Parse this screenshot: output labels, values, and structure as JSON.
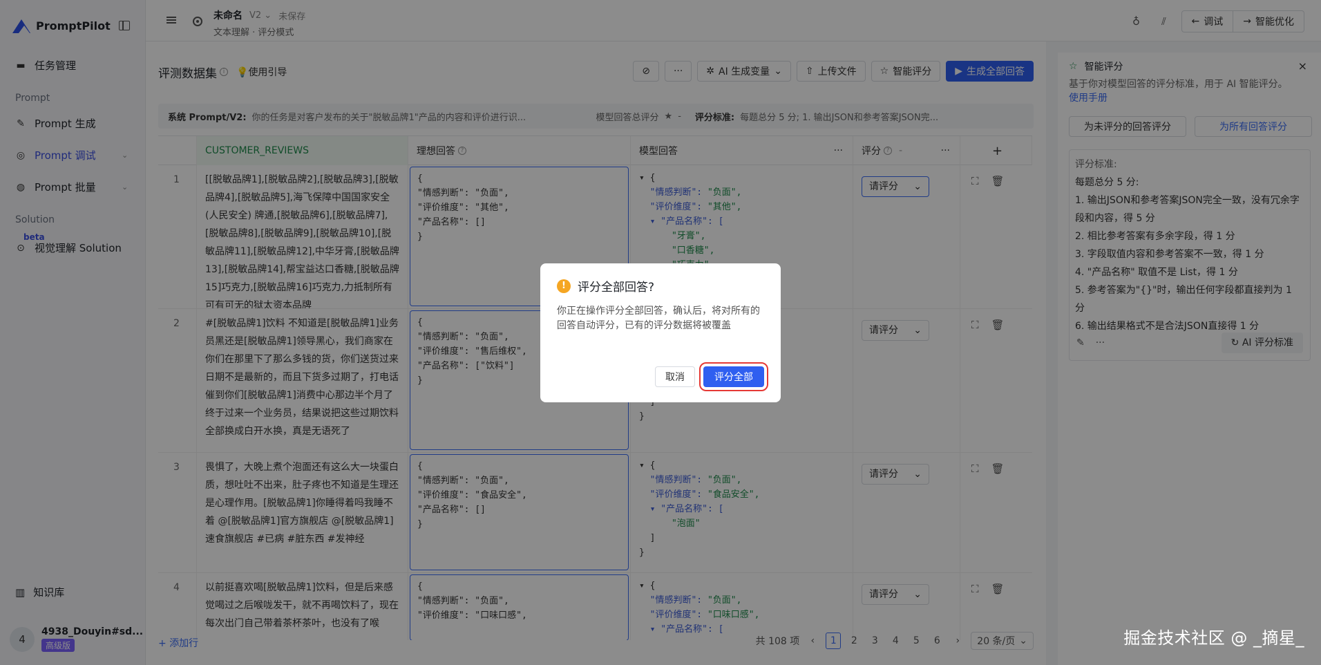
{
  "app": {
    "name": "PromptPilot"
  },
  "sidebar": {
    "items": [
      {
        "label": "任务管理",
        "icon": "folder-icon"
      },
      {
        "label": "Prompt 生成",
        "icon": "wand-icon"
      },
      {
        "label": "Prompt 调试",
        "icon": "debug-icon"
      },
      {
        "label": "Prompt 批量",
        "icon": "batch-icon"
      },
      {
        "label": "视觉理解 Solution",
        "icon": "vision-icon"
      }
    ],
    "section_prompt": "Prompt",
    "section_solution": "Solution",
    "beta": "beta",
    "knowledge": "知识库",
    "user": {
      "avatar": "4",
      "name": "4938_Douyin#sd...",
      "tier": "高级版"
    }
  },
  "header": {
    "title": "未命名",
    "version": "V2",
    "saved": "未保存",
    "subtitle": "文本理解 · 评分模式",
    "debug": "调试",
    "optimize": "智能优化"
  },
  "toolbar": {
    "title": "评测数据集",
    "guide": "使用引导",
    "ai_gen": "AI 生成变量",
    "upload": "上传文件",
    "smart_score": "智能评分",
    "gen_all": "生成全部回答"
  },
  "sysbar": {
    "label": "系统 Prompt/V2:",
    "text": "你的任务是对客户发布的关于\"脱敏品牌1\"产品的内容和评价进行识...",
    "total_label": "模型回答总评分",
    "total_value": "-",
    "std_label": "评分标准:",
    "std_text": "每题总分 5 分;  1. 输出JSON和参考答案JSON完..."
  },
  "table": {
    "headers": {
      "customer_reviews": "CUSTOMER_REVIEWS",
      "ideal": "理想回答",
      "model": "模型回答",
      "score": "评分",
      "score_dash": "-"
    },
    "rows": [
      {
        "idx": "1",
        "review": "[[脱敏品牌1],[脱敏品牌2],[脱敏品牌3],[脱敏品牌4],[脱敏品牌5],海飞保障中国国家安全(人民安全) 牌通,[脱敏品牌6],[脱敏品牌7],[脱敏品牌8],[脱敏品牌9],[脱敏品牌10],[脱敏品牌11],[脱敏品牌12],中华牙膏,[脱敏品牌13],[脱敏品牌14],帮宝益达口香糖,[脱敏品牌15]巧克力,[脱敏品牌16]巧克力,力抵制所有可有可无的狱太资本品牌",
        "ideal": [
          "{",
          "\"情感判断\": \"负面\",",
          "\"评价维度\": \"其他\",",
          "\"产品名称\": []",
          "}"
        ],
        "model": [
          [
            "▾ {",
            ""
          ],
          [
            "  \"情感判断\": ",
            "\"负面\","
          ],
          [
            "  \"评价维度\": ",
            "\"其他\","
          ],
          [
            "  ▾ \"产品名称\": [",
            ""
          ],
          [
            "      ",
            "\"牙膏\","
          ],
          [
            "      ",
            "\"口香糖\","
          ],
          [
            "      ",
            "\"巧克力\""
          ]
        ],
        "score": "请评分"
      },
      {
        "idx": "2",
        "review": "#[脱敏品牌1]饮料 不知道是[脱敏品牌1]业务员黑还是[脱敏品牌1]领导黑心，我们商家在你们在那里下了那么多钱的货，你们送货过来日期不是最新的，而且下货多过期了，打电话催到你们[脱敏品牌1]消费中心那边半个月了终于过来一个业务员，结果说把这些过期饮料全部换成白开水换，真是无语死了",
        "ideal": [
          "{",
          "\"情感判断\": \"负面\",",
          "\"评价维度\": \"售后维权\",",
          "\"产品名称\": [\"饮料\"]",
          "}"
        ],
        "model": [
          [
            "  ]",
            ""
          ],
          [
            "}",
            ""
          ]
        ],
        "score": "请评分"
      },
      {
        "idx": "3",
        "review": "畏惧了，大晚上煮个泡面还有这么大一块蛋白质，想吐吐不出来，肚子疼也不知道是生理还是心理作用。[脱敏品牌1]你睡得着吗我睡不着 @[脱敏品牌1]官方旗舰店 @[脱敏品牌1]速食旗舰店 #已病 #脏东西 #发神经",
        "ideal": [
          "{",
          "\"情感判断\": \"负面\",",
          "\"评价维度\": \"食品安全\",",
          "\"产品名称\": []",
          "}"
        ],
        "model": [
          [
            "▾ {",
            ""
          ],
          [
            "  \"情感判断\": ",
            "\"负面\","
          ],
          [
            "  \"评价维度\": ",
            "\"食品安全\","
          ],
          [
            "  ▾ \"产品名称\": [",
            ""
          ],
          [
            "      ",
            "\"泡面\""
          ],
          [
            "  ]",
            ""
          ],
          [
            "}",
            ""
          ]
        ],
        "score": "请评分"
      },
      {
        "idx": "4",
        "review": "以前挺喜欢喝[脱敏品牌1]饮料，但是后来感觉喝过之后喉咙发干，就不再喝饮料了，现在每次出门自己带着茶杯茶叶，也没有了喉",
        "ideal": [
          "{",
          "\"情感判断\": \"负面\",",
          "\"评价维度\": \"口味口感\","
        ],
        "model": [
          [
            "▾ {",
            ""
          ],
          [
            "  \"情感判断\": ",
            "\"负面\","
          ],
          [
            "  \"评价维度\": ",
            "\"口味口感\","
          ],
          [
            "  ▾ \"产品名称\": [",
            ""
          ]
        ],
        "score": "请评分"
      }
    ]
  },
  "footer": {
    "add_row": "添加行",
    "total": "共 108 项",
    "pages": [
      "1",
      "2",
      "3",
      "4",
      "5",
      "6"
    ],
    "current_page": "1",
    "page_size": "20 条/页"
  },
  "right_panel": {
    "title": "智能评分",
    "desc": "基于你对模型回答的评分标准，用于 AI 智能评分。",
    "manual": "使用手册",
    "btn_unscored": "为未评分的回答评分",
    "btn_all": "为所有回答评分",
    "criteria_label": "评分标准:",
    "criteria": [
      "每题总分 5 分:",
      "1. 输出JSON和参考答案JSON完全一致，没有冗余字段和内容，得 5 分",
      "2. 相比参考答案有多余字段，得 1 分",
      "3. 字段取值内容和参考答案不一致，得 1 分",
      "4. \"产品名称\" 取值不是 List，得 1 分",
      "5. 参考答案为\"{}\"时，输出任何字段都直接判为 1 分",
      "6. 输出结果格式不是合法JSON直接得 1 分"
    ],
    "ai_std": "AI 评分标准"
  },
  "modal": {
    "title": "评分全部回答?",
    "body": "你正在操作评分全部回答，确认后，将对所有的回答自动评分，已有的评分数据将被覆盖",
    "cancel": "取消",
    "confirm": "评分全部"
  },
  "watermark": "掘金技术社区 @ _摘星_",
  "colors": {
    "primary": "#2f5ff0",
    "accent_green": "#1f8a4c",
    "highlight_red": "#e53935",
    "warn": "#f5a623"
  }
}
